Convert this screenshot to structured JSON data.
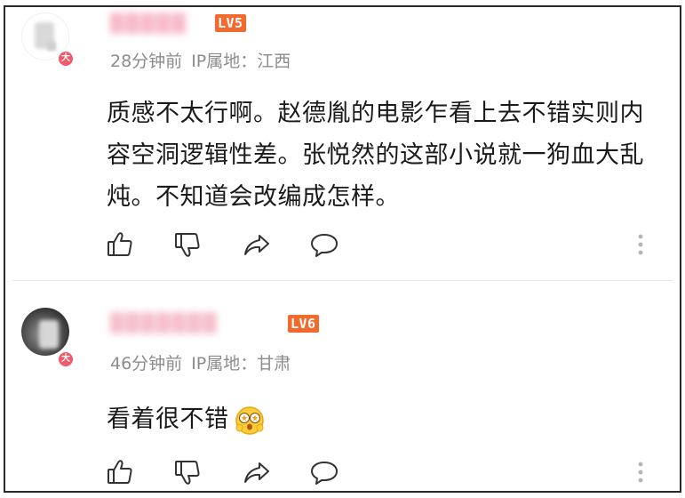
{
  "comments": [
    {
      "username": "█████",
      "level": "LV5",
      "badge": "大",
      "time": "28分钟前",
      "ip": "IP属地：江西",
      "text": "质感不太行啊。赵德胤的电影乍看上去不错实则内容空洞逻辑性差。张悦然的这部小说就一狗血大乱炖。不知道会改编成怎样。"
    },
    {
      "username": "███████",
      "level": "LV6",
      "badge": "大",
      "time": "46分钟前",
      "ip": "IP属地：甘肃",
      "text": "看着很不错",
      "emoji": "starry-eyed-emoji"
    }
  ],
  "icons": {
    "like": "thumbs-up-icon",
    "dislike": "thumbs-down-icon",
    "share": "share-arrow-icon",
    "reply": "speech-bubble-icon",
    "more": "vertical-ellipsis-icon"
  },
  "colors": {
    "level_badge": "#f26a2e",
    "da_badge": "#f05a6a",
    "username": "#f4a3b8",
    "meta": "#8c8c8c",
    "text": "#1a1a1a"
  }
}
